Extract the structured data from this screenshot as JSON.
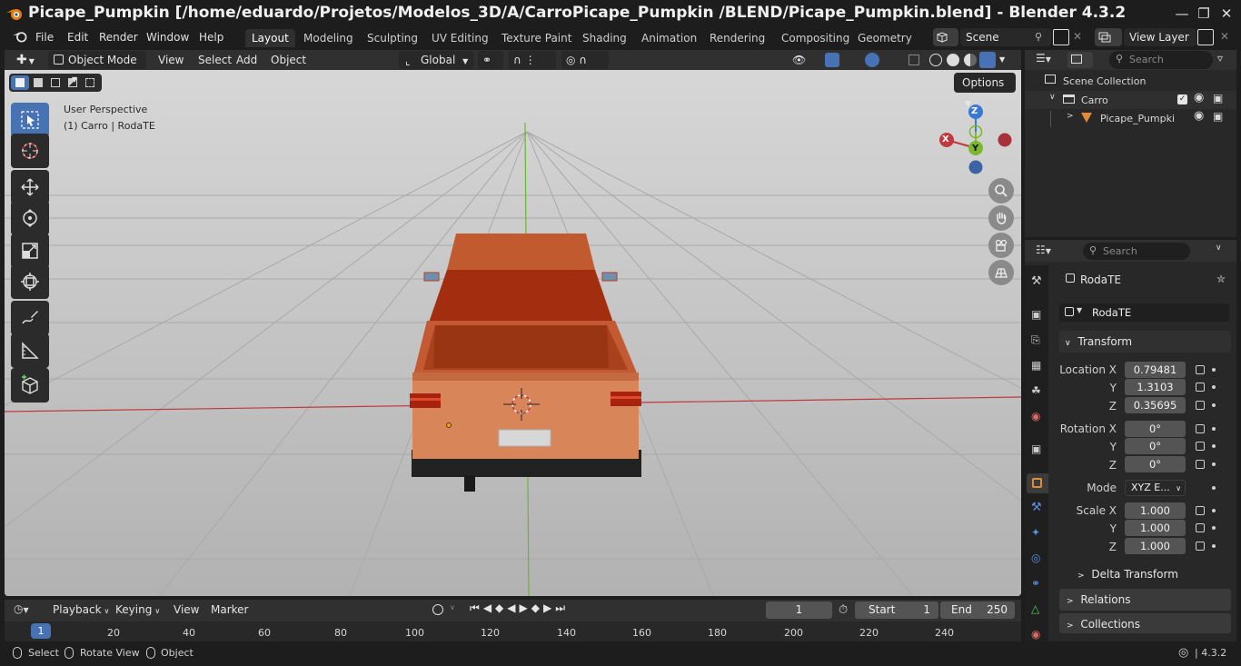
{
  "window": {
    "title": "Picape_Pumpkin [/home/eduardo/Projetos/Modelos_3D/A/CarroPicape_Pumpkin /BLEND/Picape_Pumpkin.blend] - Blender 4.3.2"
  },
  "menubar": {
    "items": [
      "File",
      "Edit",
      "Render",
      "Window",
      "Help"
    ],
    "workspaces": [
      "Layout",
      "Modeling",
      "Sculpting",
      "UV Editing",
      "Texture Paint",
      "Shading",
      "Animation",
      "Rendering",
      "Compositing",
      "Geometry Noc"
    ],
    "active_workspace": "Layout",
    "scene": "Scene",
    "view_layer": "View Layer"
  },
  "viewport": {
    "mode": "Object Mode",
    "menus": [
      "View",
      "Select",
      "Add",
      "Object"
    ],
    "orientation": "Global",
    "options_label": "Options",
    "overlay_title": "User Perspective",
    "overlay_subtitle": "(1) Carro | RodaTE",
    "gizmo": {
      "x": "X",
      "y": "Y",
      "z": "Z"
    }
  },
  "outliner": {
    "search_placeholder": "Search",
    "root": "Scene Collection",
    "collection": "Carro",
    "object": "Picape_Pumpki"
  },
  "properties": {
    "search_placeholder": "Search",
    "object_name": "RodaTE",
    "datablock_name": "RodaTE",
    "transform_label": "Transform",
    "location_label": "Location X",
    "rotation_label": "Rotation X",
    "scale_label": "Scale X",
    "y_label": "Y",
    "z_label": "Z",
    "mode_label": "Mode",
    "mode_value": "XYZ E...",
    "location": [
      "0.79481",
      "1.3103",
      "0.35695"
    ],
    "rotation": [
      "0°",
      "0°",
      "0°"
    ],
    "scale": [
      "1.000",
      "1.000",
      "1.000"
    ],
    "delta_transform": "Delta Transform",
    "relations": "Relations",
    "collections": "Collections"
  },
  "timeline": {
    "menus": [
      "Playback",
      "Keying",
      "View",
      "Marker"
    ],
    "current_frame": "1",
    "start_label": "Start",
    "start_value": "1",
    "end_label": "End",
    "end_value": "250",
    "ticks": [
      "1",
      "20",
      "40",
      "60",
      "80",
      "100",
      "120",
      "140",
      "160",
      "180",
      "200",
      "220",
      "240"
    ]
  },
  "statusbar": {
    "select": "Select",
    "rotate_view": "Rotate View",
    "object": "Object",
    "version": "4.3.2"
  },
  "colors": {
    "accent": "#4772b3",
    "truck_body": "#d8855a",
    "truck_cab": "#a83a14",
    "x_axis": "#c0393f",
    "y_axis": "#7cb82f",
    "z_axis": "#3a78d4"
  }
}
